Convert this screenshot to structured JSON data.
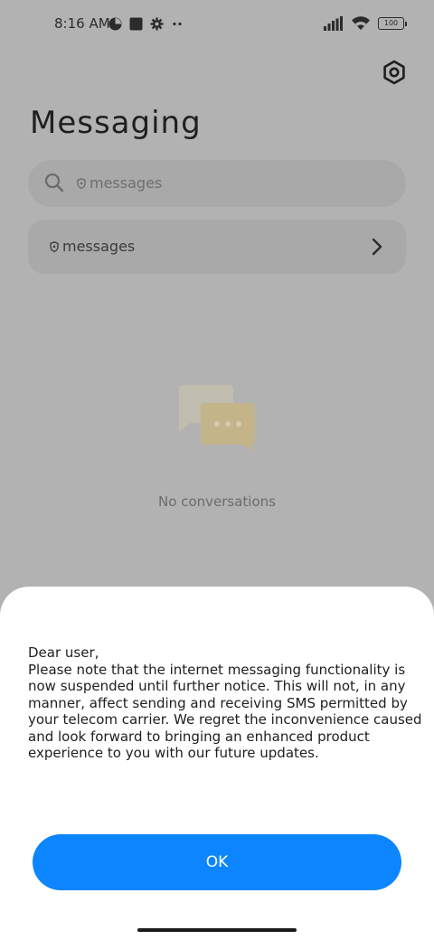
{
  "status_bar": {
    "time": "8:16 AM",
    "battery": "100",
    "icons_left": [
      "data-saver-icon",
      "square-notification-icon",
      "settings-notification-icon",
      "more-notifications-icon"
    ],
    "icons_right": [
      "signal-icon",
      "wifi-icon",
      "battery-icon"
    ]
  },
  "header": {
    "title": "Messaging",
    "settings_icon": "hexagon-settings-icon"
  },
  "search": {
    "placeholder": "messages",
    "icon": "search-icon"
  },
  "messages_card": {
    "label": "messages",
    "icon": "shield-icon",
    "chevron": "chevron-right-icon"
  },
  "empty_state": {
    "text": "No conversations"
  },
  "dialog": {
    "message": "Dear user,\nPlease note that the internet messaging functionality is now suspended until further notice. This will not, in any manner, affect sending and receiving SMS permitted by your telecom carrier. We regret the inconvenience caused and look forward to bringing an enhanced product experience to you with our future updates.",
    "ok_label": "OK"
  },
  "colors": {
    "accent": "#0d85ff",
    "dim_background": "#b2b2b2"
  }
}
